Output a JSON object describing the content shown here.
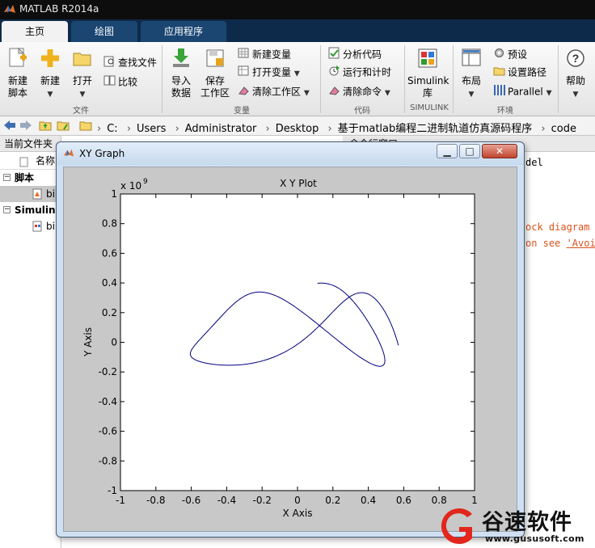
{
  "app": {
    "title": "MATLAB R2014a"
  },
  "tabs": [
    {
      "label": "主页",
      "active": true
    },
    {
      "label": "绘图",
      "active": false
    },
    {
      "label": "应用程序",
      "active": false
    }
  ],
  "ribbon": {
    "new_script": "新建\n脚本",
    "new": "新建",
    "open": "打开",
    "find_files": "查找文件",
    "compare": "比较",
    "import_data": "导入\n数据",
    "save_workspace": "保存\n工作区",
    "new_variable": "新建变量",
    "open_variable": "打开变量",
    "clear_workspace": "清除工作区",
    "analyze_code": "分析代码",
    "run_and_time": "运行和计时",
    "clear_commands": "清除命令",
    "simulink_library": "Simulink\n库",
    "layout": "布局",
    "preferences": "预设",
    "set_path": "设置路径",
    "parallel": "Parallel",
    "help": "帮助",
    "groups": {
      "file": "文件",
      "variable": "变量",
      "code": "代码",
      "simulink": "SIMULINK",
      "environment": "环境"
    }
  },
  "address": {
    "crumbs": [
      "C:",
      "Users",
      "Administrator",
      "Desktop",
      "基于matlab编程二进制轨道仿真源码程序",
      "code"
    ]
  },
  "left_panel": {
    "title": "当前文件夹",
    "column_name": "名称",
    "group_scripts": "脚本",
    "item1": "bi",
    "group_simulink": "Simulink",
    "item2": "bi"
  },
  "right_panel": {
    "title": "命令行窗口",
    "line1": "del",
    "line2": "ock diagram '",
    "line3": "on see ",
    "line3_link": "'Avoi"
  },
  "figure": {
    "window_title": "XY Graph",
    "plot_title": "X Y Plot",
    "exponent": "x 10",
    "exponent_power": "9",
    "xlabel": "X Axis",
    "ylabel": "Y Axis",
    "xlim": [
      -1,
      1
    ],
    "ylim": [
      -1,
      1
    ],
    "xticks": [
      "-1",
      "-0.8",
      "-0.6",
      "-0.4",
      "-0.2",
      "0",
      "0.2",
      "0.4",
      "0.6",
      "0.8",
      "1"
    ],
    "yticks": [
      "1",
      "0.8",
      "0.6",
      "0.4",
      "0.2",
      "0",
      "-0.2",
      "-0.4",
      "-0.6",
      "-0.8",
      "-1"
    ],
    "line_color": "#00007f"
  },
  "watermark": {
    "brand": "谷速软件",
    "url": "www.gususoft.com"
  }
}
